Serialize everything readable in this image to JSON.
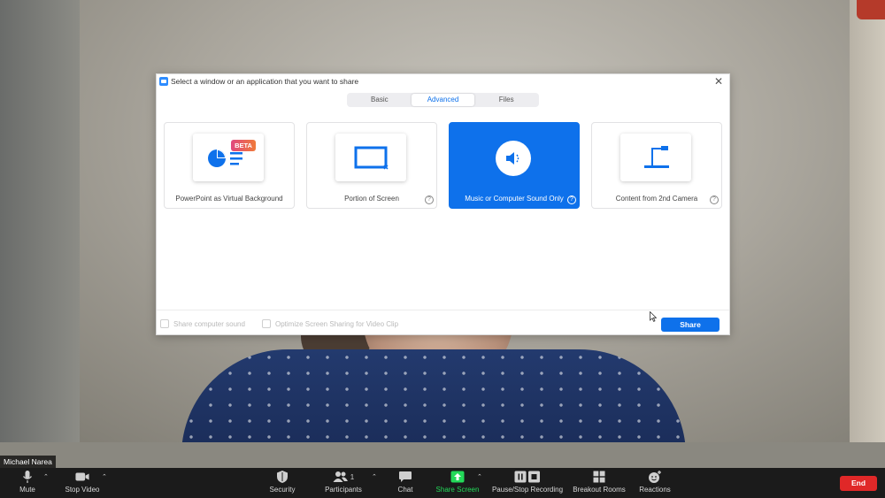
{
  "dialog": {
    "title": "Select a window or an application that you want to share",
    "close_symbol": "✕",
    "tabs": [
      {
        "label": "Basic",
        "active": false
      },
      {
        "label": "Advanced",
        "active": true
      },
      {
        "label": "Files",
        "active": false
      }
    ],
    "options": [
      {
        "label": "PowerPoint as Virtual Background",
        "badge": "BETA",
        "icon": "powerpoint-chart-icon",
        "selected": false,
        "help": false
      },
      {
        "label": "Portion of Screen",
        "icon": "screen-portion-icon",
        "selected": false,
        "help": true
      },
      {
        "label": "Music or Computer Sound Only",
        "icon": "speaker-icon",
        "selected": true,
        "help": true
      },
      {
        "label": "Content from 2nd Camera",
        "icon": "camera-stand-icon",
        "selected": false,
        "help": true
      }
    ],
    "help_symbol": "?",
    "footer": {
      "share_sound_label": "Share computer sound",
      "optimize_label": "Optimize Screen Sharing for Video Clip",
      "share_button": "Share"
    }
  },
  "participant_name": "Michael Narea",
  "toolbar": {
    "mute": "Mute",
    "stop_video": "Stop Video",
    "security": "Security",
    "participants": "Participants",
    "participants_count": "1",
    "chat": "Chat",
    "share_screen": "Share Screen",
    "recording": "Pause/Stop Recording",
    "breakout": "Breakout Rooms",
    "reactions": "Reactions",
    "end": "End"
  },
  "colors": {
    "accent": "#0e71eb",
    "share_green": "#23d959",
    "end_red": "#e02828"
  }
}
